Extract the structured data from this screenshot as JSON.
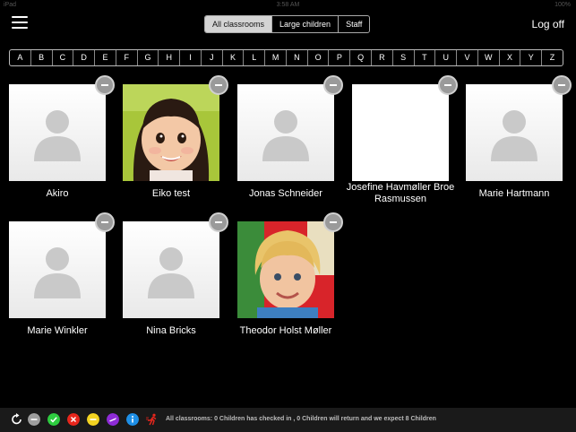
{
  "status_bar": {
    "carrier": "iPad",
    "time": "3:58 AM",
    "battery": "100%"
  },
  "nav": {
    "segments": [
      "All classrooms",
      "Large children",
      "Staff"
    ],
    "active_segment": 0,
    "logoff_label": "Log off"
  },
  "alphabet": [
    "A",
    "B",
    "C",
    "D",
    "E",
    "F",
    "G",
    "H",
    "I",
    "J",
    "K",
    "L",
    "M",
    "N",
    "O",
    "P",
    "Q",
    "R",
    "S",
    "T",
    "U",
    "V",
    "W",
    "X",
    "Y",
    "Z"
  ],
  "children": [
    {
      "name": "Akiro",
      "photo": "placeholder"
    },
    {
      "name": "Eiko test",
      "photo": "toddler-girl-photo"
    },
    {
      "name": "Jonas Schneider",
      "photo": "placeholder"
    },
    {
      "name": "Josefine Havmøller Broe Rasmussen",
      "photo": "blank"
    },
    {
      "name": "Marie Hartmann",
      "photo": "placeholder"
    },
    {
      "name": "Marie Winkler",
      "photo": "placeholder"
    },
    {
      "name": "Nina Bricks",
      "photo": "placeholder"
    },
    {
      "name": "Theodor Holst Møller",
      "photo": "boy-photo"
    }
  ],
  "bottom_bar": {
    "icons": [
      {
        "name": "refresh-icon",
        "color": "#ffffff"
      },
      {
        "name": "not-checked-in-icon",
        "color": "#9e9e9e"
      },
      {
        "name": "checked-in-icon",
        "color": "#2ecc40"
      },
      {
        "name": "absent-icon",
        "color": "#e8261c"
      },
      {
        "name": "pending-icon",
        "color": "#f3d321"
      },
      {
        "name": "trip-icon",
        "color": "#8e2bd6"
      },
      {
        "name": "info-icon",
        "color": "#1e8fe6"
      },
      {
        "name": "running-person-icon",
        "color": "#e8261c"
      }
    ],
    "status_text": "All classrooms: 0 Children has checked in , 0 Children will return and we expect 8 Children"
  }
}
